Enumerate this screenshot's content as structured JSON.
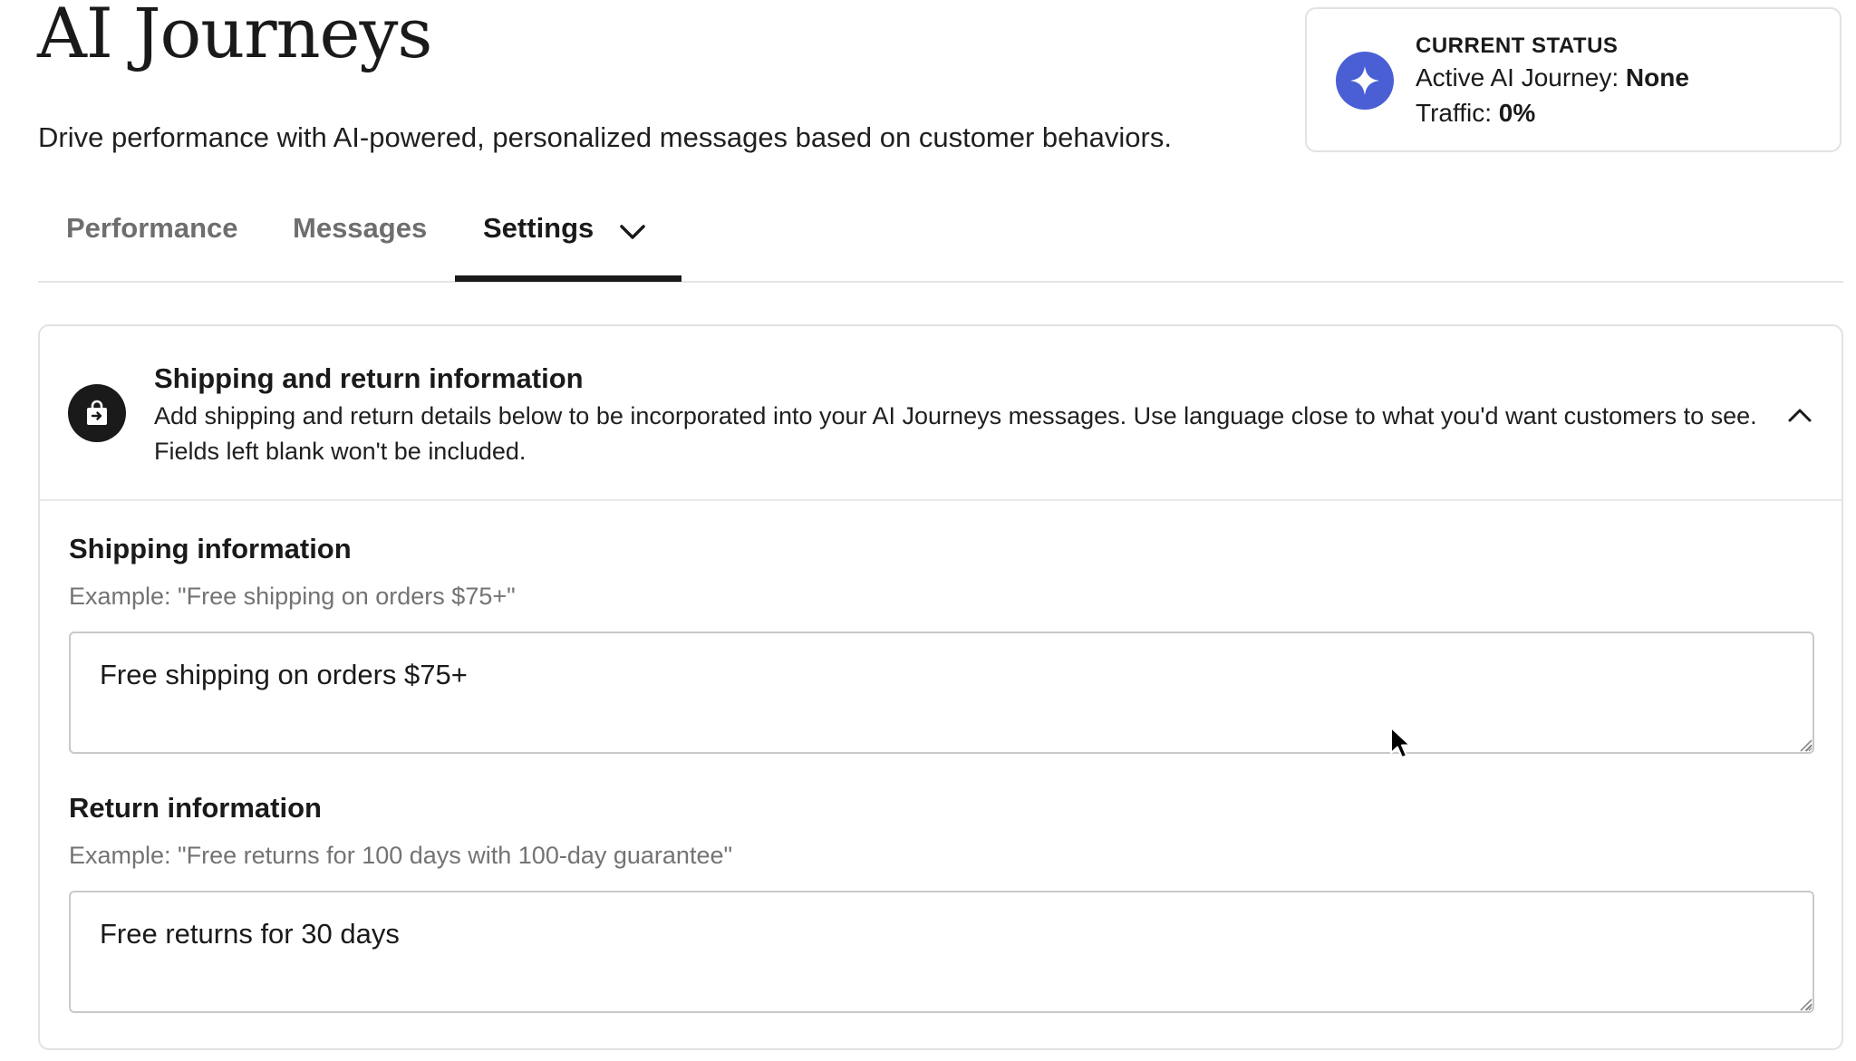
{
  "page": {
    "title": "AI Journeys",
    "subtitle": "Drive performance with AI-powered, personalized messages based on customer behaviors."
  },
  "status": {
    "heading": "CURRENT STATUS",
    "active_label": "Active AI Journey:",
    "active_value": "None",
    "traffic_label": "Traffic:",
    "traffic_value": "0%",
    "icon": "sparkle-icon",
    "icon_color": "#4a5fd4"
  },
  "tabs": [
    {
      "label": "Performance",
      "active": false
    },
    {
      "label": "Messages",
      "active": false
    },
    {
      "label": "Settings",
      "active": true,
      "icon": "chevron-down-icon"
    }
  ],
  "panel": {
    "icon": "shopping-bag-return-icon",
    "title": "Shipping and return information",
    "description": "Add shipping and return details below to be incorporated into your AI Journeys messages. Use language close to what you'd want customers to see. Fields left blank won't be included.",
    "toggle_icon": "chevron-up-icon",
    "fields": [
      {
        "label": "Shipping information",
        "example": "Example: \"Free shipping on orders $75+\"",
        "value": "Free shipping on orders $75+"
      },
      {
        "label": "Return information",
        "example": "Example: \"Free returns for 100 days with 100-day guarantee\"",
        "value": "Free returns for 30 days"
      }
    ]
  },
  "colors": {
    "accent": "#4a5fd4",
    "text": "#1a1a1a",
    "muted": "#6e6e6e",
    "border": "#e2e2e2"
  }
}
